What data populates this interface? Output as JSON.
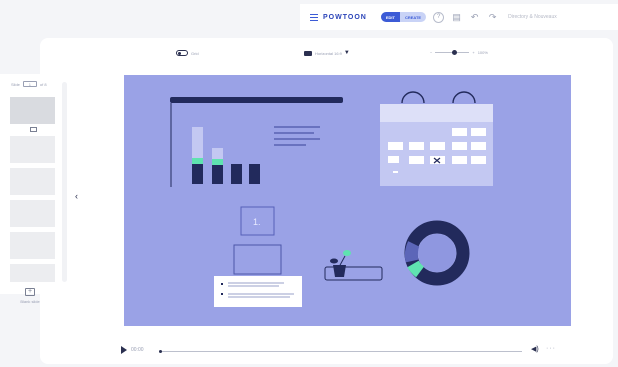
{
  "topbar": {
    "logo": "POWTOON",
    "mode_edit": "EDIT",
    "mode_create": "CREATE",
    "icons": [
      "menu-icon",
      "help-icon",
      "notes-icon",
      "undo-icon",
      "redo-icon"
    ],
    "title_placeholder": "Directory & Nouveaux"
  },
  "toolbar": {
    "grid_label": "Grid",
    "aspect_label": "Horizontal 16:9",
    "zoom_label": "100%"
  },
  "slides": {
    "counter_prefix": "Slide",
    "current": "1",
    "total_label": "of 8",
    "add_label": "Blank slide"
  },
  "playback": {
    "time": "00:00"
  },
  "canvas": {
    "background": "#9aa2e6",
    "navy": "#222a5c",
    "accent": "#5fe3b0",
    "box_label": "1."
  }
}
